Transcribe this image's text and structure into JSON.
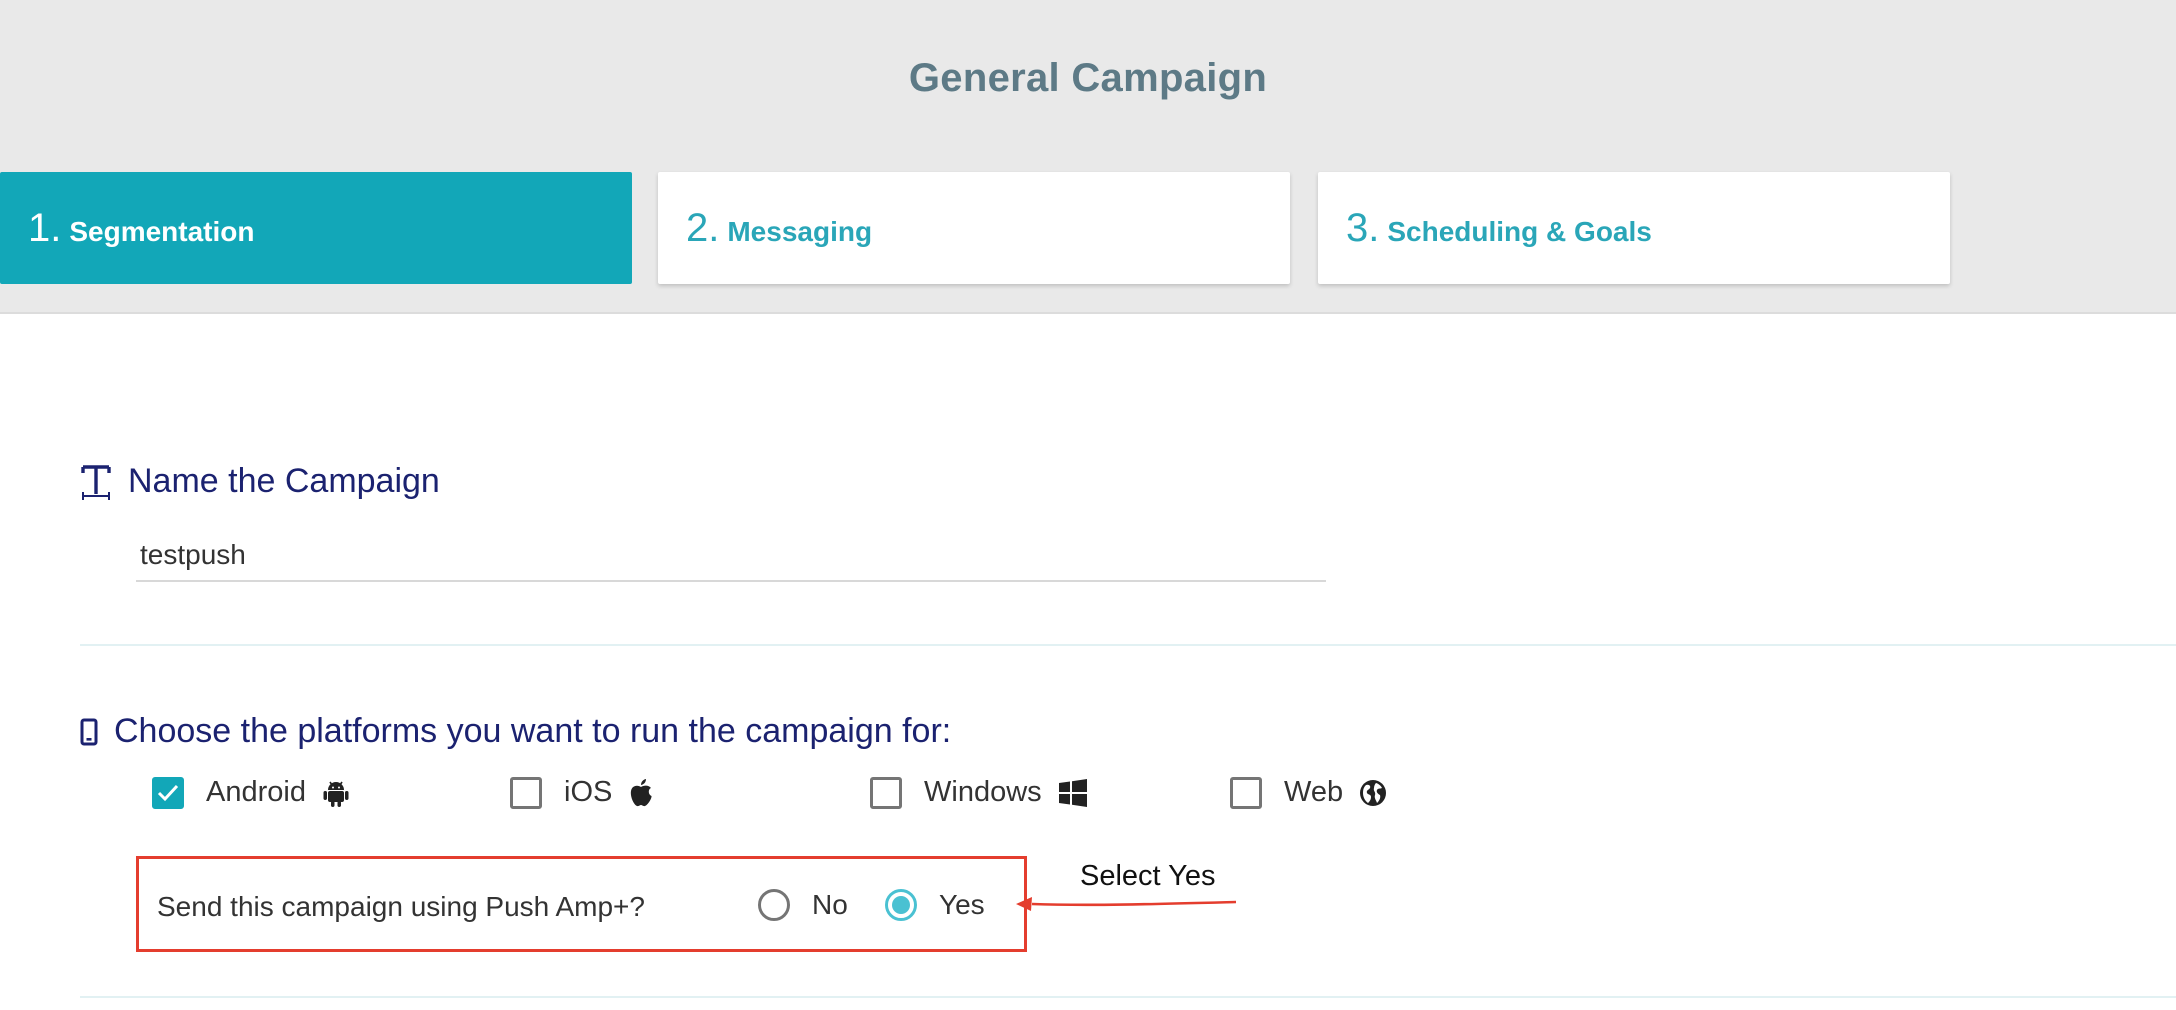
{
  "page": {
    "title": "General Campaign"
  },
  "steps": [
    {
      "num": "1.",
      "label": "Segmentation",
      "active": true
    },
    {
      "num": "2.",
      "label": "Messaging",
      "active": false
    },
    {
      "num": "3.",
      "label": "Scheduling & Goals",
      "active": false
    }
  ],
  "name_section": {
    "heading": "Name the Campaign",
    "icon": "text-field-icon",
    "input_value": "testpush"
  },
  "platform_section": {
    "heading": "Choose the platforms you want to run the campaign for:",
    "icon": "mobile-phone-icon",
    "platforms": [
      {
        "label": "Android",
        "checked": true,
        "icon": "android-icon"
      },
      {
        "label": "iOS",
        "checked": false,
        "icon": "apple-icon"
      },
      {
        "label": "Windows",
        "checked": false,
        "icon": "windows-icon"
      },
      {
        "label": "Web",
        "checked": false,
        "icon": "globe-icon"
      }
    ]
  },
  "push_amp": {
    "question": "Send this campaign using Push Amp+?",
    "options": [
      {
        "label": "No",
        "selected": false
      },
      {
        "label": "Yes",
        "selected": true
      }
    ]
  },
  "annotation": {
    "text": "Select Yes",
    "color": "#e43d2e"
  },
  "colors": {
    "accent": "#12a7b8",
    "heading": "#1b2270",
    "title": "#5d7a86",
    "highlight_box": "#e43d2e"
  }
}
